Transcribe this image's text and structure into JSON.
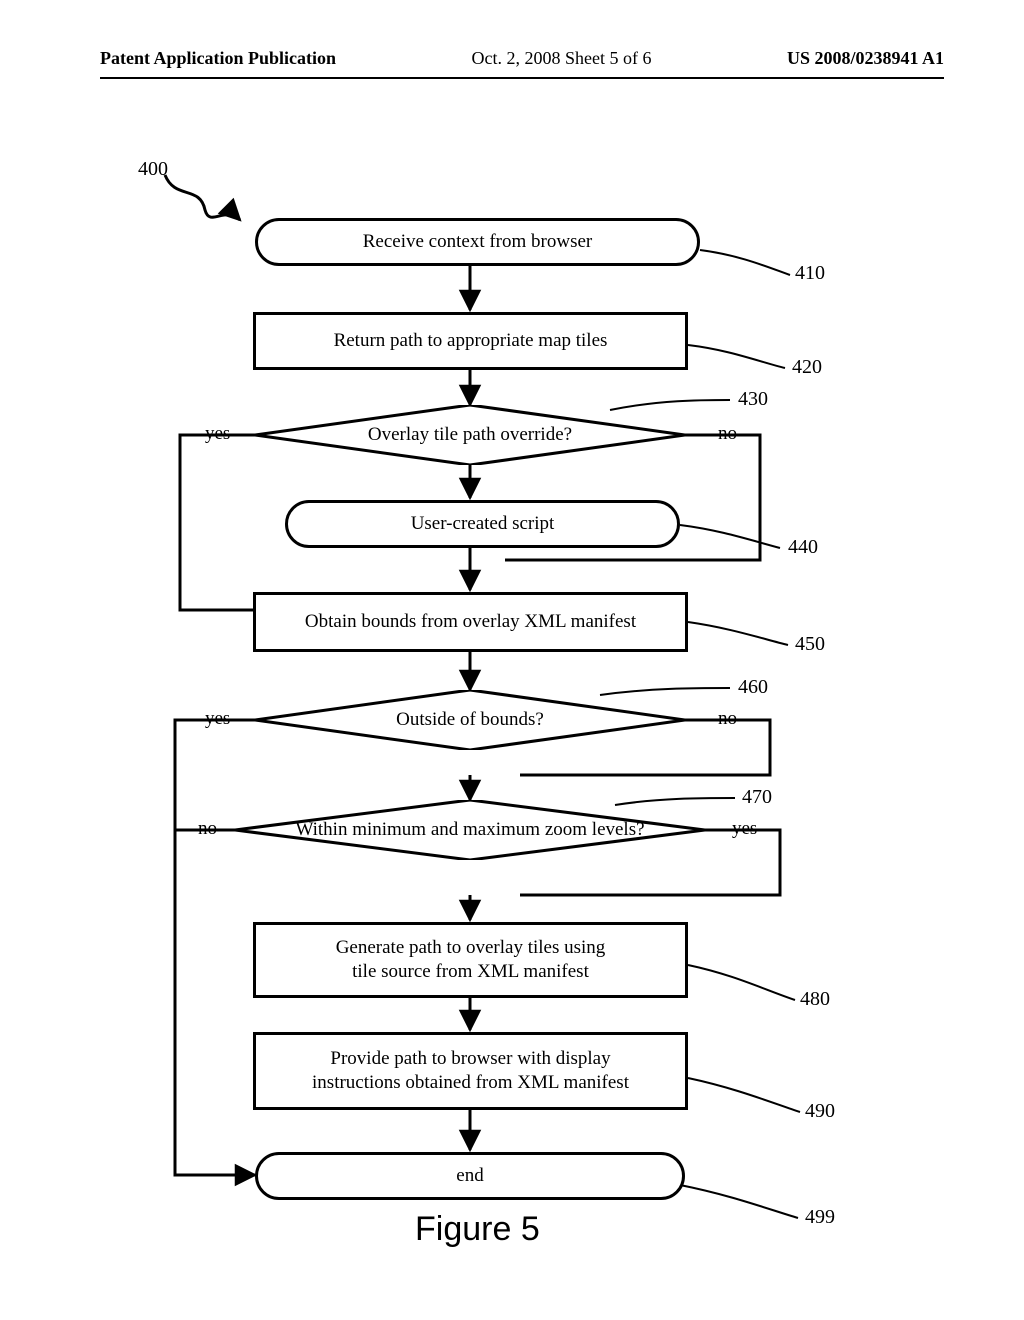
{
  "header": {
    "left": "Patent Application Publication",
    "mid": "Oct. 2, 2008  Sheet 5 of 6",
    "right": "US 2008/0238941 A1"
  },
  "refs": {
    "r400": "400",
    "r410": "410",
    "r420": "420",
    "r430": "430",
    "r440": "440",
    "r450": "450",
    "r460": "460",
    "r470": "470",
    "r480": "480",
    "r490": "490",
    "r499": "499"
  },
  "nodes": {
    "n410": "Receive context from browser",
    "n420": "Return path to appropriate map tiles",
    "n430": "Overlay tile path override?",
    "n440": "User-created script",
    "n450": "Obtain bounds from overlay XML manifest",
    "n460": "Outside of bounds?",
    "n470": "Within minimum and maximum zoom levels?",
    "n480": "Generate path to overlay tiles using\ntile source from XML manifest",
    "n490": "Provide path to browser with display\ninstructions obtained from XML manifest",
    "n499": "end"
  },
  "edges": {
    "yes": "yes",
    "no": "no"
  },
  "caption": "Figure 5",
  "chart_data": {
    "type": "flowchart",
    "title": "Figure 5",
    "reference_number": "400",
    "nodes": [
      {
        "id": "410",
        "shape": "terminator",
        "text": "Receive context from browser"
      },
      {
        "id": "420",
        "shape": "process",
        "text": "Return path to appropriate map tiles"
      },
      {
        "id": "430",
        "shape": "decision",
        "text": "Overlay tile path override?"
      },
      {
        "id": "440",
        "shape": "terminator",
        "text": "User-created script"
      },
      {
        "id": "450",
        "shape": "process",
        "text": "Obtain bounds from overlay XML manifest"
      },
      {
        "id": "460",
        "shape": "decision",
        "text": "Outside of bounds?"
      },
      {
        "id": "470",
        "shape": "decision",
        "text": "Within minimum and maximum zoom levels?"
      },
      {
        "id": "480",
        "shape": "process",
        "text": "Generate path to overlay tiles using tile source from XML manifest"
      },
      {
        "id": "490",
        "shape": "process",
        "text": "Provide path to browser with display instructions obtained from XML manifest"
      },
      {
        "id": "499",
        "shape": "terminator",
        "text": "end"
      }
    ],
    "edges": [
      {
        "from": "410",
        "to": "420"
      },
      {
        "from": "420",
        "to": "430"
      },
      {
        "from": "430",
        "to": "440",
        "label": "yes",
        "side": "left-loop-down"
      },
      {
        "from": "430",
        "to": "450",
        "label": "no",
        "side": "right-down"
      },
      {
        "from": "440",
        "to": "450"
      },
      {
        "from": "450",
        "to": "460"
      },
      {
        "from": "460",
        "to": "499",
        "label": "yes",
        "side": "left-down"
      },
      {
        "from": "460",
        "to": "470",
        "label": "no",
        "side": "right-down"
      },
      {
        "from": "470",
        "to": "499",
        "label": "no",
        "side": "left-down"
      },
      {
        "from": "470",
        "to": "480",
        "label": "yes",
        "side": "right-down"
      },
      {
        "from": "480",
        "to": "490"
      },
      {
        "from": "490",
        "to": "499"
      }
    ]
  }
}
